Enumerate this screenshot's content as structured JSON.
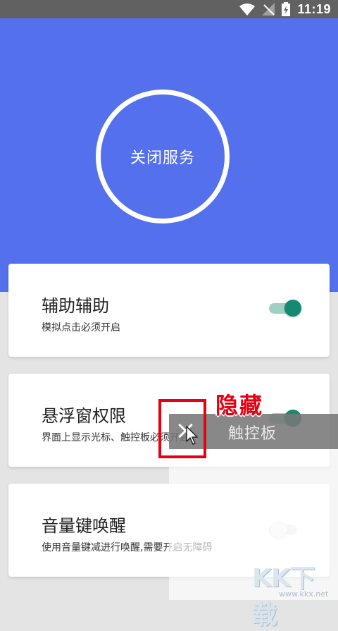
{
  "statusbar": {
    "time": "11:19",
    "icons": [
      "wifi-icon",
      "signal-off-icon",
      "battery-charging-icon"
    ]
  },
  "service": {
    "button_label": "关闭服务",
    "colors": {
      "primary": "#5470ec",
      "accent": "#158a73"
    }
  },
  "settings": [
    {
      "title": "辅助辅助",
      "desc": "模拟点击必须开启",
      "enabled": true
    },
    {
      "title": "悬浮窗权限",
      "desc": "界面上显示光标、触控板必须开启",
      "enabled": true
    },
    {
      "title": "音量键唤醒",
      "desc": "使用音量键减进行唤醒,需要开启无障碍",
      "enabled": false
    }
  ],
  "trackpad": {
    "label": "触控板",
    "annotation": "隐藏"
  },
  "watermark": {
    "logo_text": "KK下载",
    "url": "www.kkx.net"
  }
}
